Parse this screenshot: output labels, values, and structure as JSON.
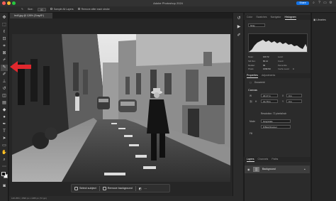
{
  "app": {
    "title": "Adobe Photoshop 2024",
    "share_label": "Share"
  },
  "options_bar": {
    "size_label": "Size:",
    "size_value": "40",
    "sample_all_layers": "Sample All Layers",
    "remove_after_stroke": "Remove after each stroke"
  },
  "document": {
    "tab_title": "leo5.jpg @ 126% (Gray/8*)",
    "status": "126.25%   |   1596 px x 1065 px (72 ppi)"
  },
  "contextual_bar": {
    "select_subject": "Select subject",
    "remove_background": "Remove background"
  },
  "histogram_panel": {
    "tabs": [
      "Color",
      "Swatches",
      "Navigator",
      "Histogram"
    ],
    "active_tab": "Histogram",
    "channel": "Gray",
    "stats": [
      {
        "label": "Mean:",
        "value": "100.72"
      },
      {
        "label": "Level:",
        "value": ""
      },
      {
        "label": "Std Dev:",
        "value": "60.12"
      },
      {
        "label": "Count:",
        "value": ""
      },
      {
        "label": "Median:",
        "value": "99"
      },
      {
        "label": "Percentile:",
        "value": ""
      },
      {
        "label": "Pixels:",
        "value": "1699740"
      },
      {
        "label": "Cache Level:",
        "value": "4"
      }
    ]
  },
  "properties_panel": {
    "tabs": [
      "Properties",
      "Adjustments"
    ],
    "active_tab": "Properties",
    "document_label": "Document",
    "canvas_title": "Canvas",
    "width_value": "22.17 in",
    "height_value": "14.79 in",
    "x_value": "0 in",
    "y_value": "0 in",
    "resolution": "Resolution: 72 pixels/inch",
    "mode_label": "Mode",
    "mode_value": "Grayscale",
    "bit_value": "8 Bits/Channel",
    "fill_label": "Fill"
  },
  "layers_panel": {
    "tabs": [
      "Layers",
      "Channels",
      "Paths"
    ],
    "active_tab": "Layers",
    "layer_name": "Background"
  },
  "right_panel": {
    "items": [
      "Libraries"
    ]
  },
  "colors": {
    "accent": "#1473e6",
    "arrow": "#e0282e"
  }
}
